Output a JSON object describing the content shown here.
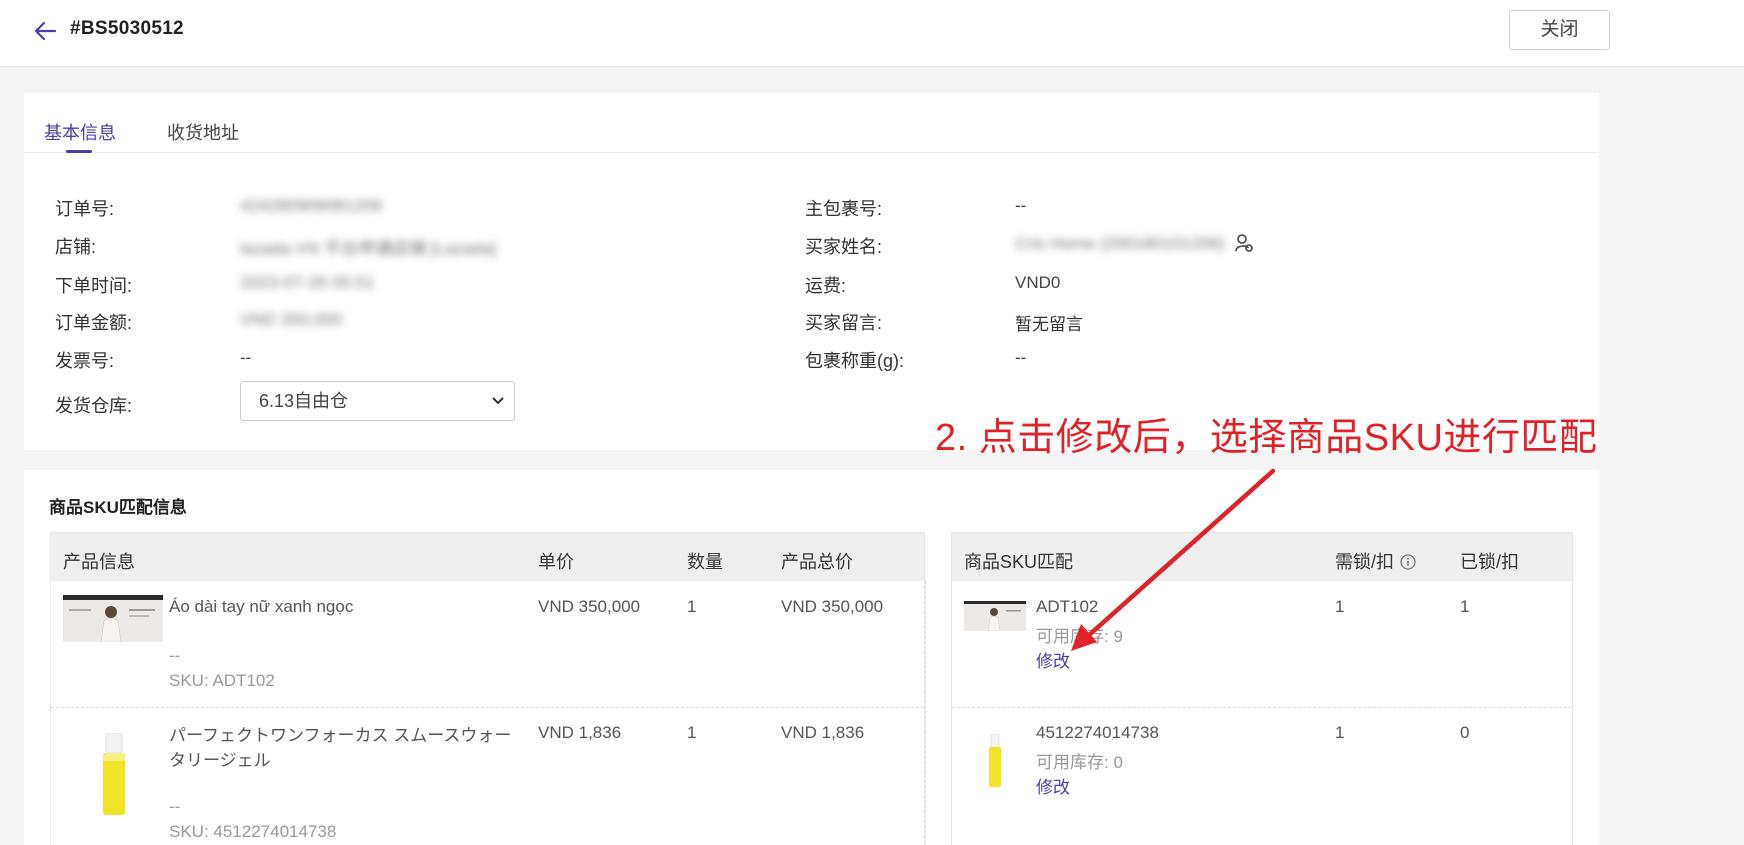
{
  "header": {
    "order_id": "#BS5030512",
    "close_label": "关闭"
  },
  "tabs": [
    {
      "label": "基本信息",
      "active": true
    },
    {
      "label": "收货地址",
      "active": false
    }
  ],
  "info_left": [
    {
      "label": "订单号:",
      "value": "424280909081209"
    },
    {
      "label": "店铺:",
      "value": "lazada-VN 平台申通店铺 [Lazada]"
    },
    {
      "label": "下单时间:",
      "value": "2023-07-26 05:51"
    },
    {
      "label": "订单金额:",
      "value": "VND 350,000"
    },
    {
      "label": "发票号:",
      "value": "--"
    },
    {
      "label": "发货仓库:",
      "value": "6.13自由仓"
    }
  ],
  "info_right": [
    {
      "label": "主包裹号:",
      "value": "--"
    },
    {
      "label": "买家姓名:",
      "value": "Cris Home (200180101206)"
    },
    {
      "label": "运费:",
      "value": "VND0"
    },
    {
      "label": "买家留言:",
      "value": "暂无留言"
    },
    {
      "label": "包裹称重(g):",
      "value": "--"
    }
  ],
  "annotation": "2. 点击修改后，选择商品SKU进行匹配",
  "sku_section": {
    "title": "商品SKU匹配信息",
    "left_headers": [
      "产品信息",
      "单价",
      "数量",
      "产品总价"
    ],
    "right_headers": [
      "商品SKU匹配",
      "需锁/扣",
      "已锁/扣"
    ],
    "products": [
      {
        "name": "Áo dài tay nữ xanh ngọc",
        "variant": "--",
        "sku": "SKU: ADT102",
        "price": "VND 350,000",
        "qty": "1",
        "total": "VND 350,000",
        "match_sku": "ADT102",
        "stock": "可用库存: 9",
        "edit": "修改",
        "need": "1",
        "locked": "1"
      },
      {
        "name": "パーフェクトワンフォーカス スムースウォータリージェル",
        "variant": "--",
        "sku": "SKU: 4512274014738",
        "price": "VND 1,836",
        "qty": "1",
        "total": "VND 1,836",
        "match_sku": "4512274014738",
        "stock": "可用库存: 0",
        "edit": "修改",
        "need": "1",
        "locked": "0"
      }
    ]
  },
  "colors": {
    "accent": "#4b3fa3",
    "annotation": "#e0222a"
  },
  "icons": [
    "back-arrow-icon",
    "chevron-down-icon",
    "buyer-contact-icon",
    "info-icon"
  ]
}
